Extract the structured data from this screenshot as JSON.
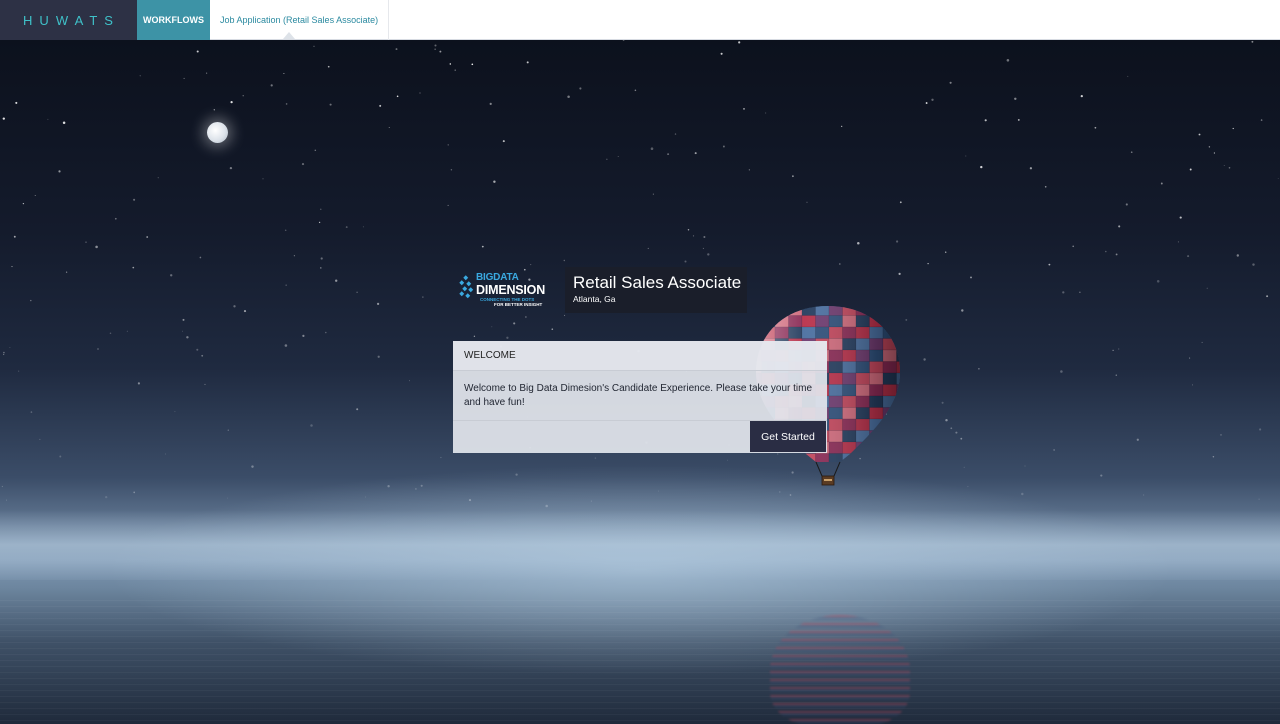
{
  "app": {
    "brand": "HUWATS"
  },
  "nav": {
    "workflows_label": "WORKFLOWS",
    "breadcrumb_label": "Job Application (Retail Sales Associate)"
  },
  "company": {
    "logo_line1": "BIGDATA",
    "logo_line2": "DIMENSION",
    "logo_tagline1": "CONNECTING THE DOTS",
    "logo_tagline2": "FOR BETTER INSIGHT"
  },
  "job": {
    "title": "Retail Sales Associate",
    "location": "Atlanta, Ga"
  },
  "welcome": {
    "header": "WELCOME",
    "message": "Welcome to Big Data Dimesion's Candidate Experience. Please take your time and have fun!",
    "button_label": "Get Started"
  },
  "colors": {
    "brand_bg": "#2d3145",
    "brand_text": "#3fc1c9",
    "nav_active": "#3d93a6",
    "link": "#2b8aa0",
    "button_bg": "#2a2d44",
    "logo_blue": "#3aa9e0"
  }
}
